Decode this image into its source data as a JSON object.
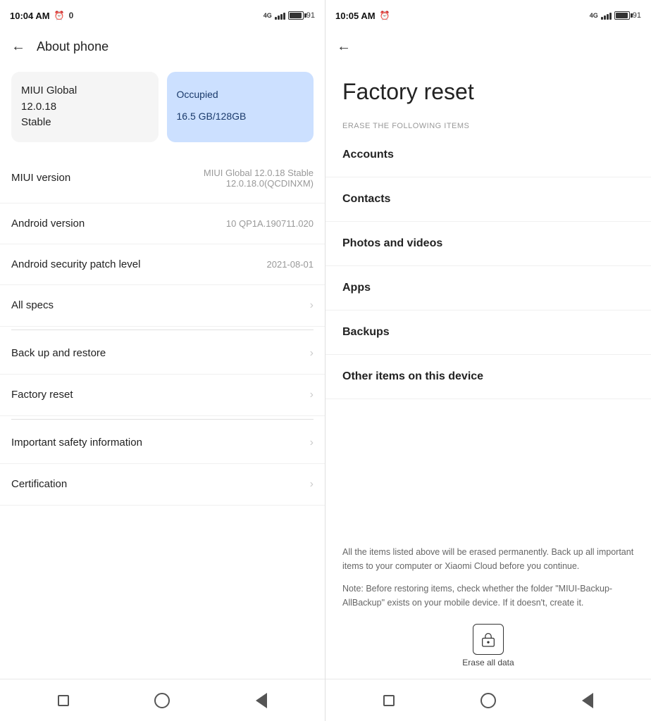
{
  "left": {
    "statusBar": {
      "time": "10:04 AM",
      "alarmIcon": "⏰",
      "network": "4G",
      "signal": "▋▋▋▋",
      "battery": "91",
      "notification": "0"
    },
    "topBar": {
      "backLabel": "←",
      "title": "About phone"
    },
    "miuiCard": {
      "line1": "MIUI Global",
      "line2": "12.0.18",
      "line3": "Stable"
    },
    "storageCard": {
      "label": "Occupied",
      "value": "16.5 GB",
      "total": "/128GB"
    },
    "rows": [
      {
        "label": "MIUI version",
        "value": "MIUI Global 12.0.18 Stable\n12.0.18.0(QCDINXM)",
        "hasChevron": false
      },
      {
        "label": "Android version",
        "value": "10 QP1A.190711.020",
        "hasChevron": false
      },
      {
        "label": "Android security patch level",
        "value": "2021-08-01",
        "hasChevron": false
      },
      {
        "label": "All specs",
        "value": "",
        "hasChevron": true
      }
    ],
    "rows2": [
      {
        "label": "Back up and restore",
        "value": "",
        "hasChevron": true
      },
      {
        "label": "Factory reset",
        "value": "",
        "hasChevron": true
      }
    ],
    "rows3": [
      {
        "label": "Important safety information",
        "value": "",
        "hasChevron": true
      },
      {
        "label": "Certification",
        "value": "",
        "hasChevron": true
      }
    ],
    "navBar": {
      "square": "■",
      "circle": "●",
      "triangle": "◀"
    }
  },
  "right": {
    "statusBar": {
      "time": "10:05 AM",
      "alarmIcon": "⏰",
      "network": "4G",
      "signal": "▋▋▋▋",
      "battery": "91"
    },
    "topBar": {
      "backLabel": "←"
    },
    "title": "Factory reset",
    "eraseLabel": "ERASE THE FOLLOWING ITEMS",
    "items": [
      "Accounts",
      "Contacts",
      "Photos and videos",
      "Apps",
      "Backups",
      "Other items on this device"
    ],
    "warning1": "All the items listed above will be erased permanently. Back up all important items to your computer or Xiaomi Cloud before you continue.",
    "warning2": "Note: Before restoring items, check whether the folder \"MIUI-Backup-AllBackup\" exists on your mobile device. If it doesn't, create it.",
    "eraseBtn": "Erase all data",
    "navBar": {
      "square": "■",
      "circle": "●",
      "triangle": "◀"
    }
  }
}
